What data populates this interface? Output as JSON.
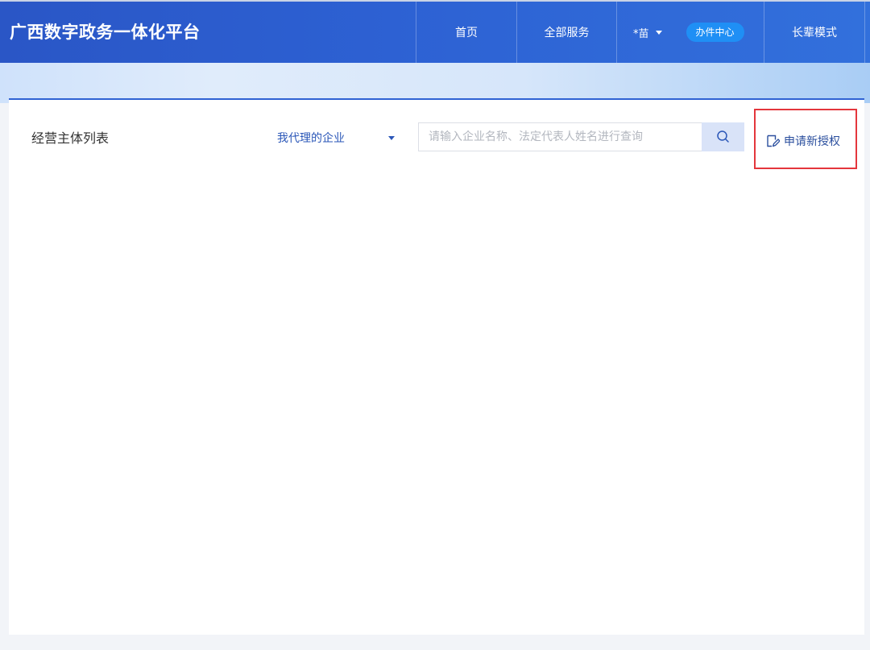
{
  "header": {
    "title": "广西数字政务一体化平台",
    "nav": {
      "home": "首页",
      "all_services": "全部服务",
      "user_name": "*苗",
      "office_center": "办件中心",
      "elder_mode": "长辈模式"
    }
  },
  "panel": {
    "title": "经营主体列表",
    "scope_select": {
      "selected": "我代理的企业"
    },
    "search": {
      "placeholder": "请输入企业名称、法定代表人姓名进行查询",
      "value": ""
    },
    "apply_button": "申请新授权"
  },
  "colors": {
    "header_bg": "#2d61d3",
    "accent": "#2f62d3",
    "badge": "#1f8ff5",
    "highlight_box": "#e4363c"
  },
  "icons": [
    "search-icon",
    "edit-icon",
    "chevron-down-icon"
  ]
}
